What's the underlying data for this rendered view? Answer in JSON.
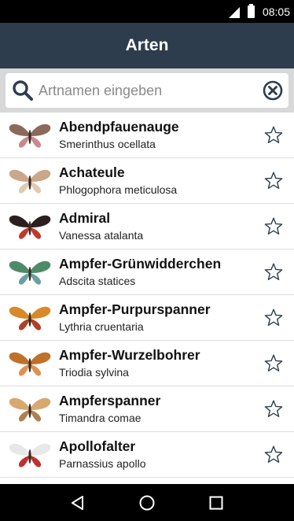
{
  "status_bar": {
    "time": "08:05"
  },
  "app_bar": {
    "title": "Arten"
  },
  "search": {
    "placeholder": "Artnamen eingeben",
    "value": ""
  },
  "species": [
    {
      "name": "Abendpfauenauge",
      "latin": "Smerinthus ocellata",
      "wing_color": "#8a6a5a",
      "accent": "#c98a8a"
    },
    {
      "name": "Achateule",
      "latin": "Phlogophora meticulosa",
      "wing_color": "#c9a78a",
      "accent": "#e2c9b0"
    },
    {
      "name": "Admiral",
      "latin": "Vanessa atalanta",
      "wing_color": "#2a2020",
      "accent": "#c0392b"
    },
    {
      "name": "Ampfer-Grünwidderchen",
      "latin": "Adscita statices",
      "wing_color": "#4e8a6a",
      "accent": "#6aa0a0"
    },
    {
      "name": "Ampfer-Purpurspanner",
      "latin": "Lythria cruentaria",
      "wing_color": "#d88a2a",
      "accent": "#b0402a"
    },
    {
      "name": "Ampfer-Wurzelbohrer",
      "latin": "Triodia sylvina",
      "wing_color": "#c0702a",
      "accent": "#e09050"
    },
    {
      "name": "Ampferspanner",
      "latin": "Timandra comae",
      "wing_color": "#d8a870",
      "accent": "#b08050"
    },
    {
      "name": "Apollofalter",
      "latin": "Parnassius apollo",
      "wing_color": "#e8e8e8",
      "accent": "#c03030"
    }
  ],
  "colors": {
    "app_bar": "#2e3d4d",
    "search_background": "#d8d8d8",
    "icon_dark": "#2e3d4d"
  },
  "icons": {
    "search": "search-icon",
    "clear": "clear-icon",
    "favorite": "star-outline-icon",
    "nav": [
      "back-icon",
      "home-icon",
      "recents-icon"
    ]
  }
}
